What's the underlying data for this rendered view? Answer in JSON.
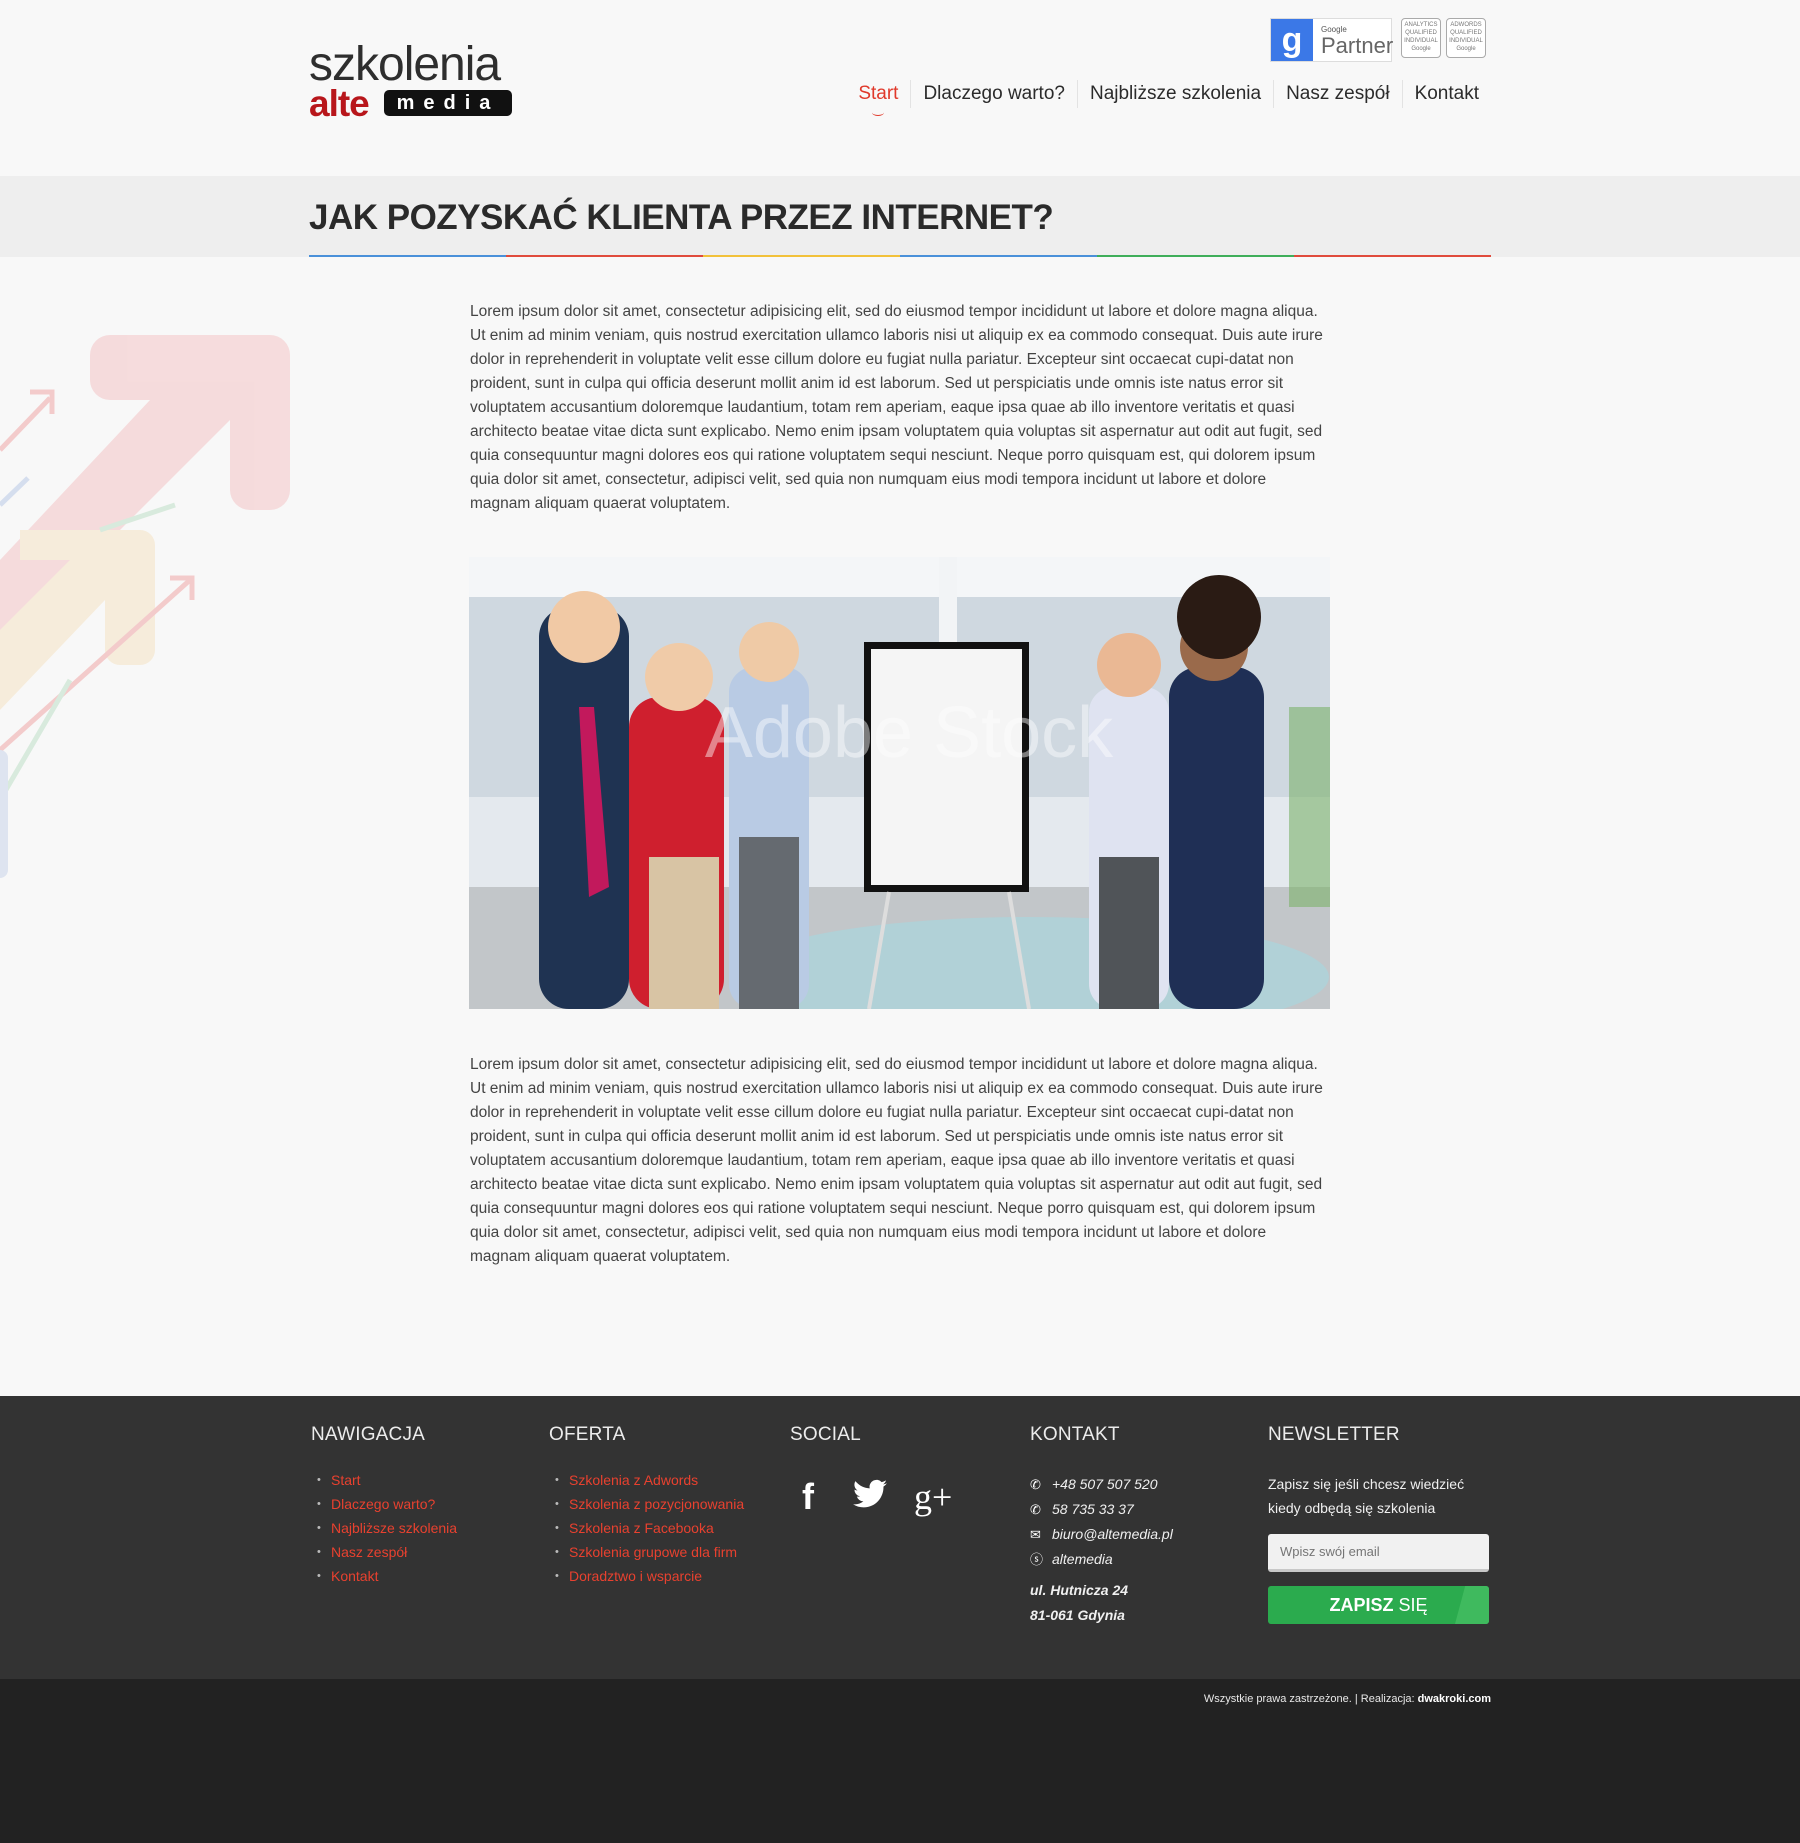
{
  "header": {
    "logo_line1": "szkolenia",
    "logo_line2": "alte",
    "logo_line3": "media",
    "partner_small": "Google",
    "partner_big": "Partner",
    "cert1": "ANALYTICS QUALIFIED INDIVIDUAL Google",
    "cert2": "ADWORDS QUALIFIED INDIVIDUAL Google",
    "nav": [
      {
        "label": "Start",
        "active": true
      },
      {
        "label": "Dlaczego warto?"
      },
      {
        "label": "Najbliższe szkolenia"
      },
      {
        "label": "Nasz zespół"
      },
      {
        "label": "Kontakt"
      }
    ]
  },
  "page": {
    "title": "JAK POZYSKAĆ KLIENTA PRZEZ INTERNET?",
    "paragraph1": "Lorem ipsum dolor sit amet, consectetur adipisicing elit, sed do eiusmod tempor incididunt ut labore et dolore magna aliqua. Ut enim ad minim veniam, quis nostrud exercitation ullamco laboris nisi ut aliquip ex ea commodo consequat. Duis aute irure dolor in reprehenderit in voluptate velit esse cillum dolore eu fugiat nulla pariatur. Excepteur sint occaecat cupi-datat non proident, sunt in culpa qui officia deserunt mollit anim id est laborum. Sed ut perspiciatis unde omnis iste natus error sit voluptatem accusantium doloremque laudantium, totam rem aperiam, eaque ipsa quae ab illo inventore veritatis et quasi architecto beatae vitae dicta sunt explicabo. Nemo enim ipsam voluptatem quia voluptas sit aspernatur aut odit aut fugit, sed quia consequuntur magni dolores eos qui ratione voluptatem sequi nesciunt. Neque porro quisquam est, qui dolorem ipsum quia dolor sit amet, consectetur, adipisci velit, sed quia non numquam eius modi tempora incidunt ut labore et dolore magnam aliquam quaerat voluptatem.",
    "photo_watermark": "Adobe Stock",
    "paragraph2": "Lorem ipsum dolor sit amet, consectetur adipisicing elit, sed do eiusmod tempor incididunt ut labore et dolore magna aliqua. Ut enim ad minim veniam, quis nostrud exercitation ullamco laboris nisi ut aliquip ex ea commodo consequat. Duis aute irure dolor in reprehenderit in voluptate velit esse cillum dolore eu fugiat nulla pariatur. Excepteur sint occaecat cupi-datat non proident, sunt in culpa qui officia deserunt mollit anim id est laborum. Sed ut perspiciatis unde omnis iste natus error sit voluptatem accusantium doloremque laudantium, totam rem aperiam, eaque ipsa quae ab illo inventore veritatis et quasi architecto beatae vitae dicta sunt explicabo. Nemo enim ipsam voluptatem quia voluptas sit aspernatur aut odit aut fugit, sed quia consequuntur magni dolores eos qui ratione voluptatem sequi nesciunt. Neque porro quisquam est, qui dolorem ipsum quia dolor sit amet, consectetur, adipisci velit, sed quia non numquam eius modi tempora incidunt ut labore et dolore magnam aliquam quaerat voluptatem."
  },
  "footer": {
    "nav_title": "NAWIGACJA",
    "nav_items": [
      "Start",
      "Dlaczego warto?",
      "Najbliższe szkolenia",
      "Nasz zespół",
      "Kontakt"
    ],
    "offer_title": "OFERTA",
    "offer_items": [
      "Szkolenia z Adwords",
      "Szkolenia z pozycjonowania",
      "Szkolenia z Facebooka",
      "Szkolenia grupowe dla firm",
      "Doradztwo i wsparcie"
    ],
    "social_title": "SOCIAL",
    "social_icons": [
      "facebook-icon",
      "twitter-icon",
      "google-plus-icon"
    ],
    "contact_title": "KONTAKT",
    "phone1": "+48 507 507 520",
    "phone2": "58 735 33 37",
    "email": "biuro@altemedia.pl",
    "skype": "altemedia",
    "address1": "ul. Hutnicza 24",
    "address2": "81-061 Gdynia",
    "newsletter_title": "NEWSLETTER",
    "newsletter_text": "Zapisz się jeśli chcesz wiedzieć kiedy odbędą się szkolenia",
    "newsletter_placeholder": "Wpisz swój email",
    "newsletter_button_bold": "ZAPISZ",
    "newsletter_button_rest": "SIĘ"
  },
  "bottom": {
    "rights": "Wszystkie prawa zastrzeżone.",
    "separator": "|",
    "made_by_label": "Realizacja:",
    "made_by": "dwakroki.com"
  },
  "colors": {
    "accent": "#e0392b",
    "footer_bg": "#333333",
    "bottom_bg": "#222222",
    "button_green": "#2bab4e",
    "rainbow": [
      "#4a90d9",
      "#e04b3c",
      "#f2c13a",
      "#4a90d9",
      "#3fae5a",
      "#e04b3c"
    ]
  }
}
